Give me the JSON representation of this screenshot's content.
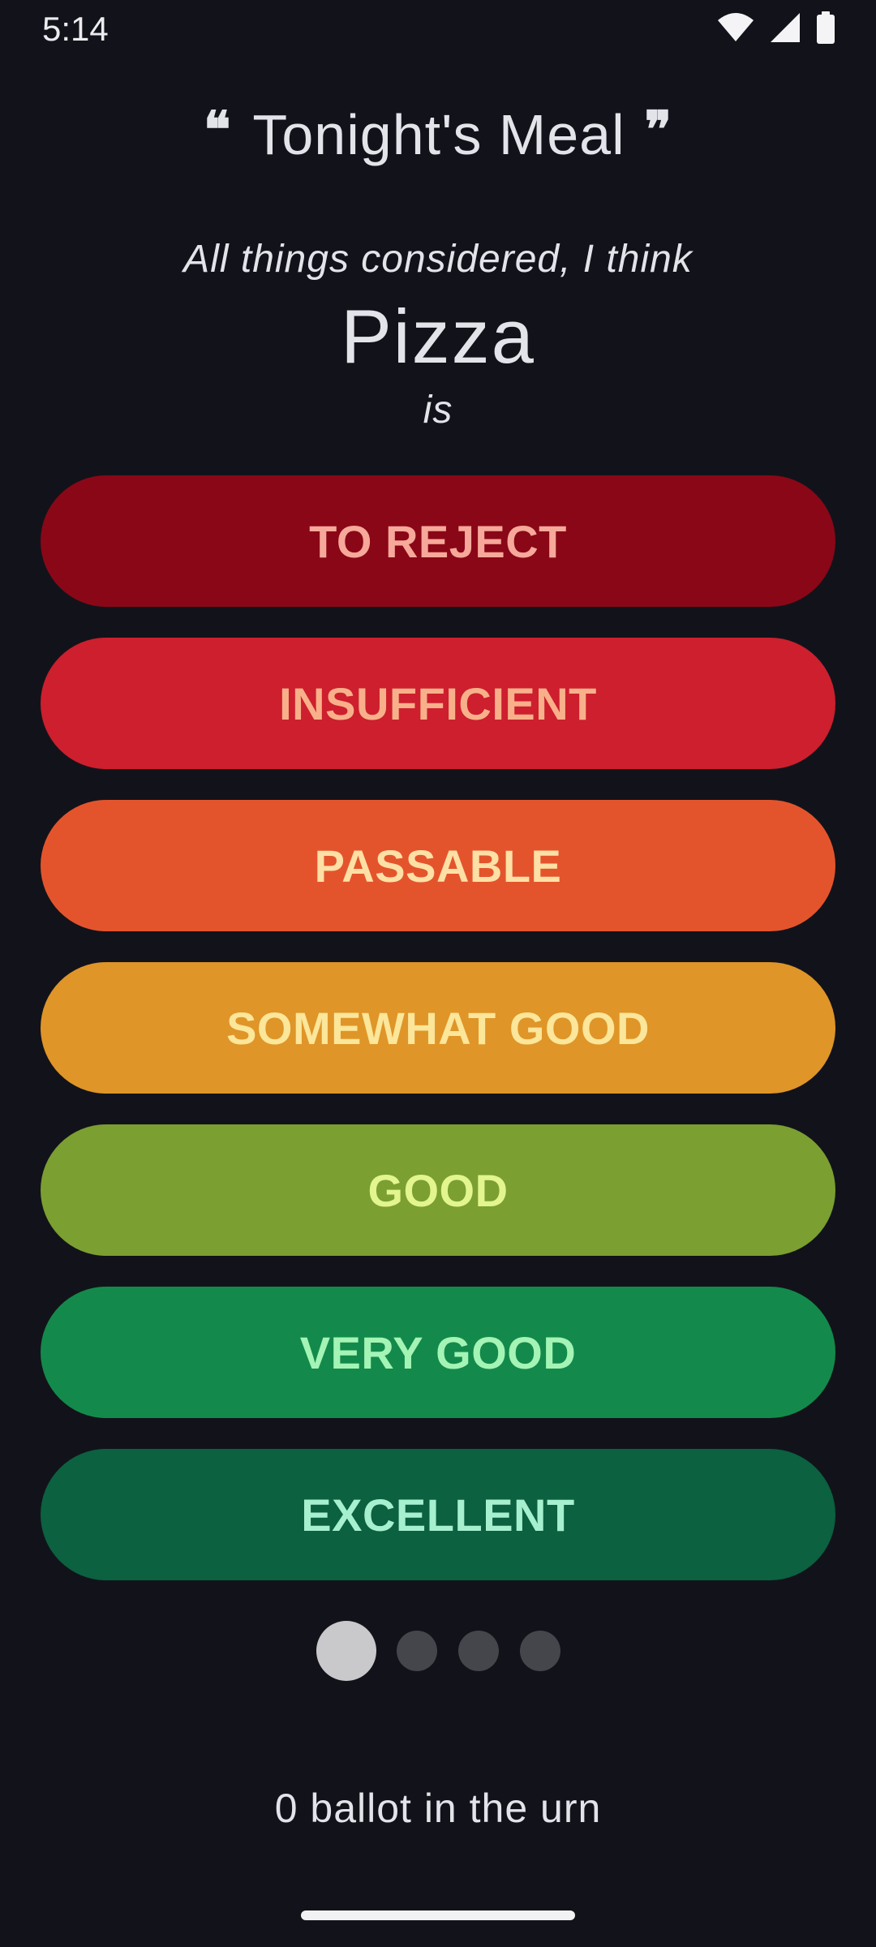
{
  "status_bar": {
    "time": "5:14",
    "icons": [
      "wifi-icon",
      "cell-signal-icon",
      "battery-icon"
    ]
  },
  "header": {
    "open_quote": "❝",
    "title": "Tonight's Meal",
    "close_quote": "❞"
  },
  "prompt": {
    "intro": "All things considered, I think",
    "subject": "Pizza",
    "copula": "is"
  },
  "grades": [
    {
      "label": "TO REJECT",
      "bg": "#8a0717",
      "fg": "#f6a89a"
    },
    {
      "label": "INSUFFICIENT",
      "bg": "#cd1f2e",
      "fg": "#f8b08a"
    },
    {
      "label": "PASSABLE",
      "bg": "#e4542c",
      "fg": "#fde0a6"
    },
    {
      "label": "SOMEWHAT GOOD",
      "bg": "#df9528",
      "fg": "#fbe69a"
    },
    {
      "label": "GOOD",
      "bg": "#7b9f31",
      "fg": "#e2f58e"
    },
    {
      "label": "VERY GOOD",
      "bg": "#138a4b",
      "fg": "#a4f4b6"
    },
    {
      "label": "EXCELLENT",
      "bg": "#0b6140",
      "fg": "#a6f0cf"
    }
  ],
  "pager": {
    "current_page": 1,
    "total_pages": 4
  },
  "footer": {
    "ballot_count_text": "0 ballot in the urn"
  },
  "colors": {
    "background": "#12131a",
    "text": "#e3e3ea",
    "pager_active": "#c9c9cc",
    "pager_inactive": "#45464c"
  }
}
